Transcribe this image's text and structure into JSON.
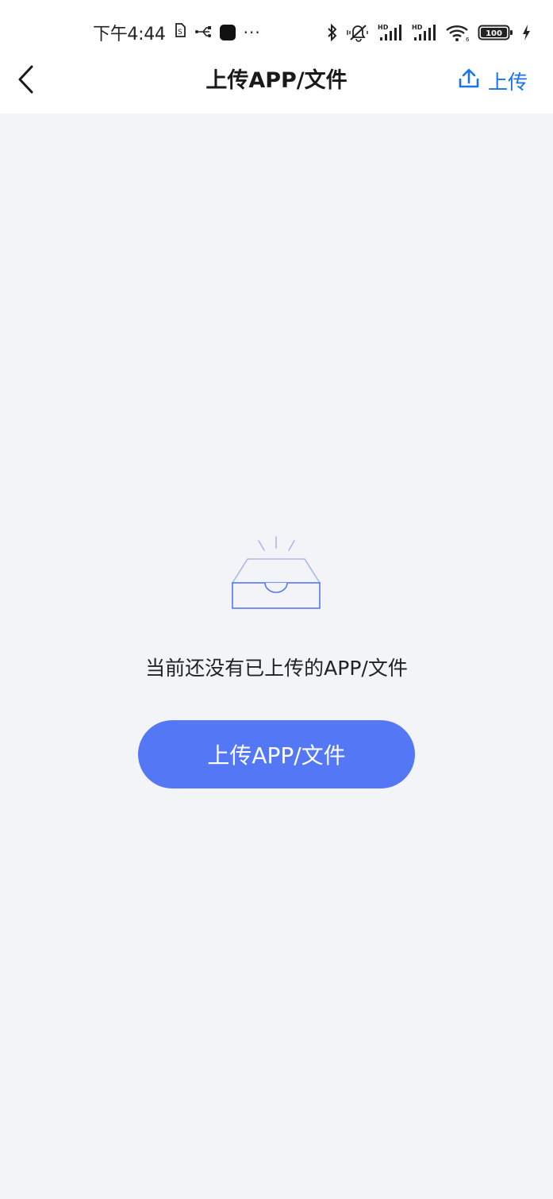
{
  "status_bar": {
    "time": "下午4:44",
    "overflow": "···",
    "battery": "100",
    "icons": [
      "sim-icon",
      "usb-icon",
      "app-notification-icon",
      "bluetooth-icon",
      "mute-icon",
      "signal-hd-icon",
      "signal-hd-icon",
      "wifi-icon",
      "battery-icon",
      "charging-icon"
    ]
  },
  "nav": {
    "back_icon": "chevron-left-icon",
    "title": "上传APP/文件",
    "upload_label": "上传",
    "upload_icon": "upload-icon"
  },
  "empty_state": {
    "icon": "empty-tray-icon",
    "message": "当前还没有已上传的APP/文件",
    "button_label": "上传APP/文件"
  },
  "colors": {
    "accent": "#1a73e8",
    "button": "#5478f5",
    "background": "#f2f4f8"
  }
}
